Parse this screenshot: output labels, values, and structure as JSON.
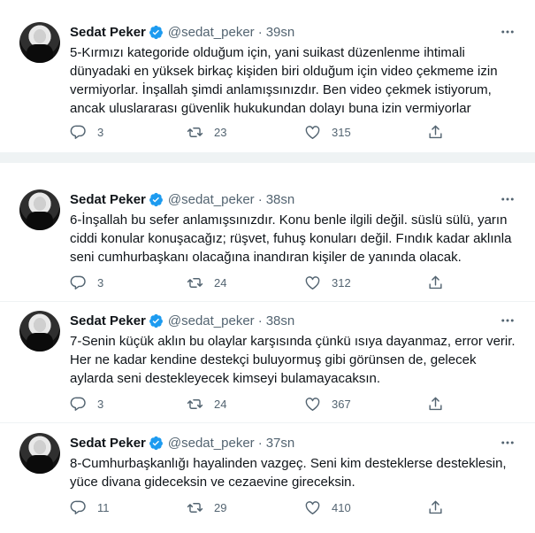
{
  "tweets": [
    {
      "name": "Sedat Peker",
      "handle": "@sedat_peker",
      "separator": "·",
      "time": "39sn",
      "text": "5-Kırmızı kategoride olduğum için, yani suikast düzenlenme ihtimali\ndünyadaki en yüksek birkaç kişiden biri olduğum için video çekmeme izin\nvermiyorlar. İnşallah şimdi anlamışsınızdır. Ben video çekmek istiyorum,\nancak uluslararası güvenlik hukukundan dolayı buna izin vermiyorlar",
      "replies": "3",
      "retweets": "23",
      "likes": "315"
    },
    {
      "name": "Sedat Peker",
      "handle": "@sedat_peker",
      "separator": "·",
      "time": "38sn",
      "text": "6-İnşallah bu sefer anlamışsınızdır. Konu benle ilgili değil. süslü sülü, yarın\nciddi konular konuşacağız; rüşvet, fuhuş konuları değil. Fındık kadar aklınla\nseni cumhurbaşkanı olacağına inandıran kişiler de yanında olacak.",
      "replies": "3",
      "retweets": "24",
      "likes": "312"
    },
    {
      "name": "Sedat Peker",
      "handle": "@sedat_peker",
      "separator": "·",
      "time": "38sn",
      "text": "7-Senin küçük aklın bu olaylar karşısında çünkü ısıya dayanmaz, error verir.\nHer ne kadar kendine destekçi buluyormuş gibi görünsen de, gelecek\naylarda seni destekleyecek kimseyi bulamayacaksın.",
      "replies": "3",
      "retweets": "24",
      "likes": "367"
    },
    {
      "name": "Sedat Peker",
      "handle": "@sedat_peker",
      "separator": "·",
      "time": "37sn",
      "text": "8-Cumhurbaşkanlığı hayalinden vazgeç. Seni kim desteklerse desteklesin,\nyüce divana gideceksin ve cezaevine gireceksin.",
      "replies": "11",
      "retweets": "29",
      "likes": "410"
    }
  ],
  "colors": {
    "text": "#0f1419",
    "muted": "#536471",
    "verified": "#1d9bf0",
    "divider": "#eff3f4"
  },
  "icons": [
    "verified-badge-icon",
    "more-options-icon",
    "reply-icon",
    "retweet-icon",
    "like-icon",
    "share-icon"
  ]
}
